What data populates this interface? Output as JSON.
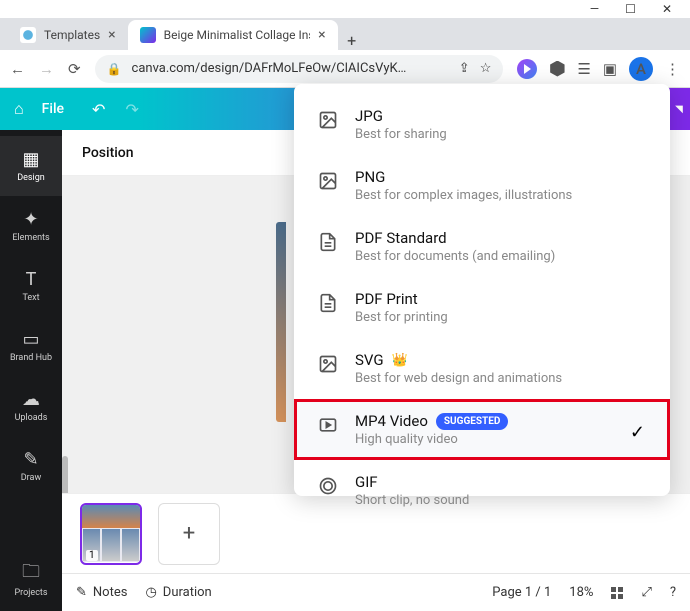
{
  "window": {
    "min": "—",
    "max": "☐",
    "close": "✕"
  },
  "tabs": [
    {
      "label": "Templates"
    },
    {
      "label": "Beige Minimalist Collage Ins"
    }
  ],
  "newtab": "+",
  "addr": {
    "url": "canva.com/design/DAFrMoLFeOw/ClAICsVyK…",
    "avatar": "A"
  },
  "canva": {
    "file": "File"
  },
  "sidebar": [
    {
      "label": "Design"
    },
    {
      "label": "Elements"
    },
    {
      "label": "Text",
      "glyph": "T"
    },
    {
      "label": "Brand Hub"
    },
    {
      "label": "Uploads"
    },
    {
      "label": "Draw"
    },
    {
      "label": "Projects"
    }
  ],
  "sub": {
    "position": "Position"
  },
  "menu": [
    {
      "title": "JPG",
      "desc": "Best for sharing"
    },
    {
      "title": "PNG",
      "desc": "Best for complex images, illustrations"
    },
    {
      "title": "PDF Standard",
      "desc": "Best for documents (and emailing)"
    },
    {
      "title": "PDF Print",
      "desc": "Best for printing"
    },
    {
      "title": "SVG",
      "desc": "Best for web design and animations",
      "crown": "👑"
    },
    {
      "title": "MP4 Video",
      "desc": "High quality video",
      "badge": "SUGGESTED"
    },
    {
      "title": "GIF",
      "desc": "Short clip, no sound"
    }
  ],
  "footer": {
    "notes": "Notes",
    "duration": "Duration",
    "page": "Page 1 / 1",
    "zoom": "18%"
  },
  "thumb": {
    "num": "1"
  },
  "addpage": "+"
}
